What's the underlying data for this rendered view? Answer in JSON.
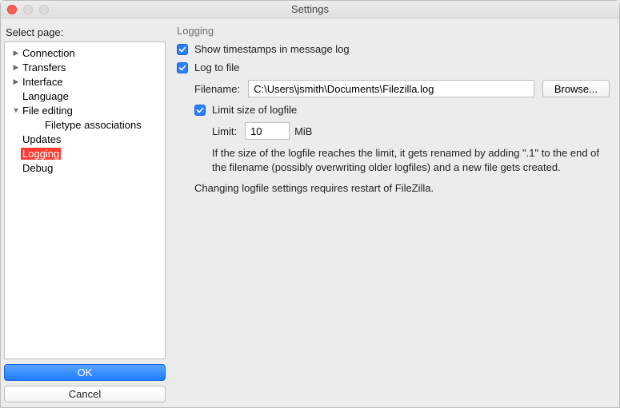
{
  "window": {
    "title": "Settings"
  },
  "sidebar": {
    "label": "Select page:",
    "items": {
      "connection": "Connection",
      "transfers": "Transfers",
      "interface": "Interface",
      "language": "Language",
      "file_editing": "File editing",
      "filetype_assoc": "Filetype associations",
      "updates": "Updates",
      "logging": "Logging",
      "debug": "Debug"
    },
    "buttons": {
      "ok": "OK",
      "cancel": "Cancel"
    }
  },
  "main": {
    "section_title": "Logging",
    "show_timestamps": {
      "checked": true,
      "label": "Show timestamps in message log"
    },
    "log_to_file": {
      "checked": true,
      "label": "Log to file"
    },
    "filename": {
      "label": "Filename:",
      "value": "C:\\Users\\jsmith\\Documents\\Filezilla.log",
      "browse": "Browse..."
    },
    "limit_size": {
      "checked": true,
      "label": "Limit size of logfile"
    },
    "limit": {
      "label": "Limit:",
      "value": "10",
      "unit": "MiB"
    },
    "note": "If the size of the logfile reaches the limit, it gets renamed by adding \".1\" to the end of the filename (possibly overwriting older logfiles) and a new file gets created.",
    "restart_note": "Changing logfile settings requires restart of FileZilla."
  }
}
